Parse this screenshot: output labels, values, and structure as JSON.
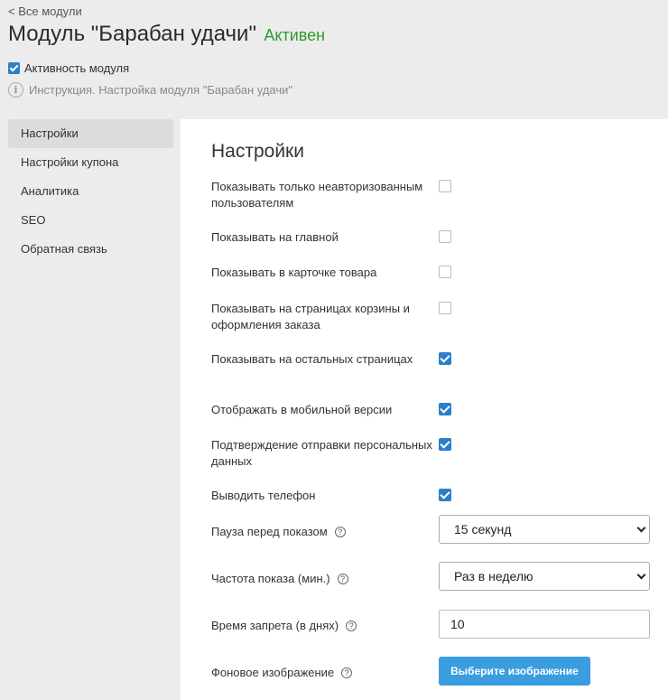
{
  "header": {
    "back_link": "< Все модули",
    "title": "Модуль \"Барабан удачи\"",
    "status": "Активен",
    "module_active_label": "Активность модуля",
    "instruction_link": "Инструкция. Настройка модуля \"Барабан удачи\""
  },
  "sidebar": {
    "items": [
      {
        "label": "Настройки",
        "active": true
      },
      {
        "label": "Настройки купона",
        "active": false
      },
      {
        "label": "Аналитика",
        "active": false
      },
      {
        "label": "SEO",
        "active": false
      },
      {
        "label": "Обратная связь",
        "active": false
      }
    ]
  },
  "main": {
    "section_title": "Настройки",
    "options": [
      {
        "label": "Показывать только неавторизованным пользователям",
        "checked": false
      },
      {
        "label": "Показывать на главной",
        "checked": false
      },
      {
        "label": "Показывать в карточке товара",
        "checked": false
      },
      {
        "label": "Показывать на страницах корзины и оформления заказа",
        "checked": false
      },
      {
        "label": "Показывать на остальных страницах",
        "checked": true
      },
      {
        "label": "Отображать в мобильной версии",
        "checked": true
      },
      {
        "label": "Подтверждение отправки персональных данных",
        "checked": true
      },
      {
        "label": "Выводить телефон",
        "checked": true
      }
    ],
    "pause": {
      "label": "Пауза перед показом",
      "value": "15 секунд"
    },
    "frequency": {
      "label": "Частота показа (мин.)",
      "value": "Раз в неделю"
    },
    "ban_time": {
      "label": "Время запрета (в днях)",
      "value": "10"
    },
    "background": {
      "label": "Фоновое изображение",
      "button_label": "Выберите изображение"
    },
    "help_glyph": "?"
  },
  "colors": {
    "accent": "#2d7ec9",
    "status_green": "#2e9b2e",
    "button_blue": "#3a9de0"
  }
}
